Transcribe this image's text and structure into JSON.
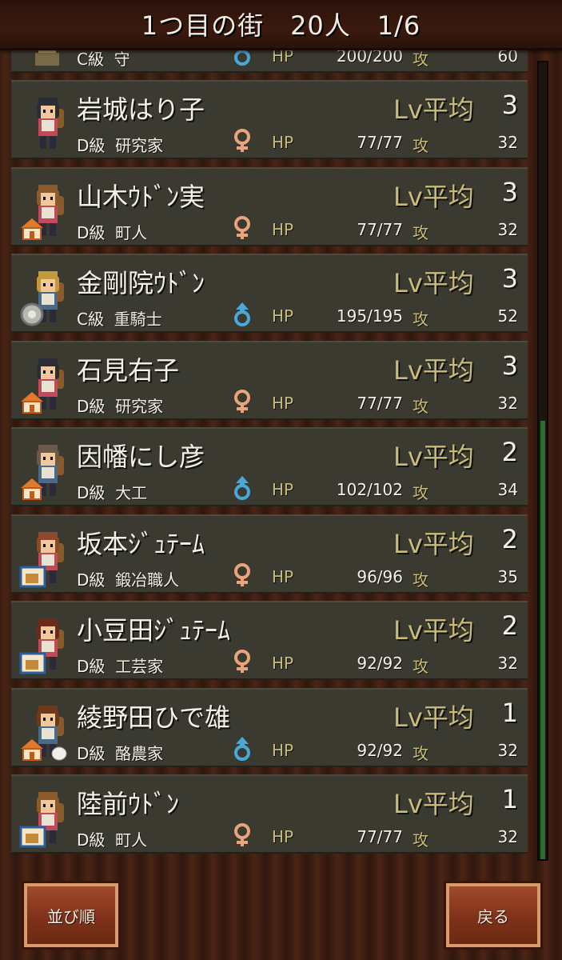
{
  "header": {
    "title": "1つ目の街　20人　1/6"
  },
  "labels": {
    "lv": "Lv平均",
    "hp": "HP",
    "atk": "攻"
  },
  "partial_top_row": {
    "rank_job": "C級  守",
    "hp_value": "200/200",
    "atk_value": "60"
  },
  "characters": [
    {
      "name": "岩城はり子",
      "rank_job": "D級  研究家",
      "gender": "female",
      "lv": "3",
      "hp": "77/77",
      "atk": "32",
      "house": "none",
      "hair": "#2b2d36"
    },
    {
      "name": "山木ｳﾄﾞﾝ実",
      "rank_job": "D級  町人",
      "gender": "female",
      "lv": "3",
      "hp": "77/77",
      "atk": "32",
      "house": "orange",
      "hair": "#8b5a2b"
    },
    {
      "name": "金剛院ｳﾄﾞﾝ",
      "rank_job": "C級  重騎士",
      "gender": "male",
      "lv": "3",
      "hp": "195/195",
      "atk": "52",
      "house": "shield",
      "hair": "#c29a3b"
    },
    {
      "name": "石見右子",
      "rank_job": "D級  研究家",
      "gender": "female",
      "lv": "3",
      "hp": "77/77",
      "atk": "32",
      "house": "orange",
      "hair": "#2b2d36"
    },
    {
      "name": "因幡にし彦",
      "rank_job": "D級  大工",
      "gender": "male",
      "lv": "2",
      "hp": "102/102",
      "atk": "34",
      "house": "orange",
      "hair": "#6b5a4a"
    },
    {
      "name": "坂本ｼﾞｭﾃｰﾑ",
      "rank_job": "D級  鍛冶職人",
      "gender": "female",
      "lv": "2",
      "hp": "96/96",
      "atk": "35",
      "house": "blue",
      "hair": "#8b4a2b"
    },
    {
      "name": "小豆田ｼﾞｭﾃｰﾑ",
      "rank_job": "D級  工芸家",
      "gender": "female",
      "lv": "2",
      "hp": "92/92",
      "atk": "32",
      "house": "blue",
      "hair": "#6b2a1b"
    },
    {
      "name": "綾野田ひで雄",
      "rank_job": "D級  酪農家",
      "gender": "male",
      "lv": "1",
      "hp": "92/92",
      "atk": "32",
      "house": "orange-egg",
      "hair": "#6b3a1b"
    },
    {
      "name": "陸前ｳﾄﾞﾝ",
      "rank_job": "D級  町人",
      "gender": "female",
      "lv": "1",
      "hp": "77/77",
      "atk": "32",
      "house": "blue",
      "hair": "#8b5a2b"
    }
  ],
  "colors": {
    "female_icon": "#e8a47a",
    "male_icon": "#4aa8d8",
    "row_bg": "#3b3a30",
    "label_gold": "#c9bc79",
    "scroll_green": "#2f6b33"
  },
  "scrollbar": {
    "thumb_start_fraction": 0.45,
    "thumb_end_fraction": 1.0
  },
  "buttons": {
    "sort": "並び順",
    "back": "戻る"
  }
}
